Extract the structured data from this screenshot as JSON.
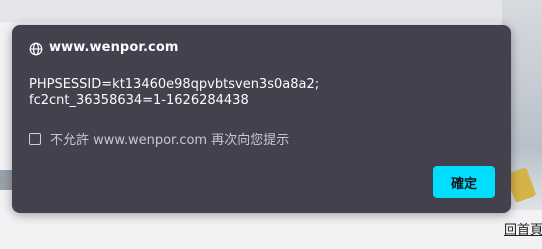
{
  "background": {
    "link_text": "回首頁"
  },
  "dialog": {
    "icon": "globe-icon",
    "title": "www.wenpor.com",
    "message_lines": [
      "PHPSESSID=kt13460e98qpvbtsven3s0a8a2;",
      "fc2cnt_36358634=1-1626284438"
    ],
    "checkbox_label": "不允許 www.wenpor.com 再次向您提示",
    "checkbox_checked": false,
    "ok_button_label": "確定"
  },
  "colors": {
    "dialog_bg": "#42414d",
    "button_bg": "#00ddff",
    "text": "#fbfbfe"
  }
}
